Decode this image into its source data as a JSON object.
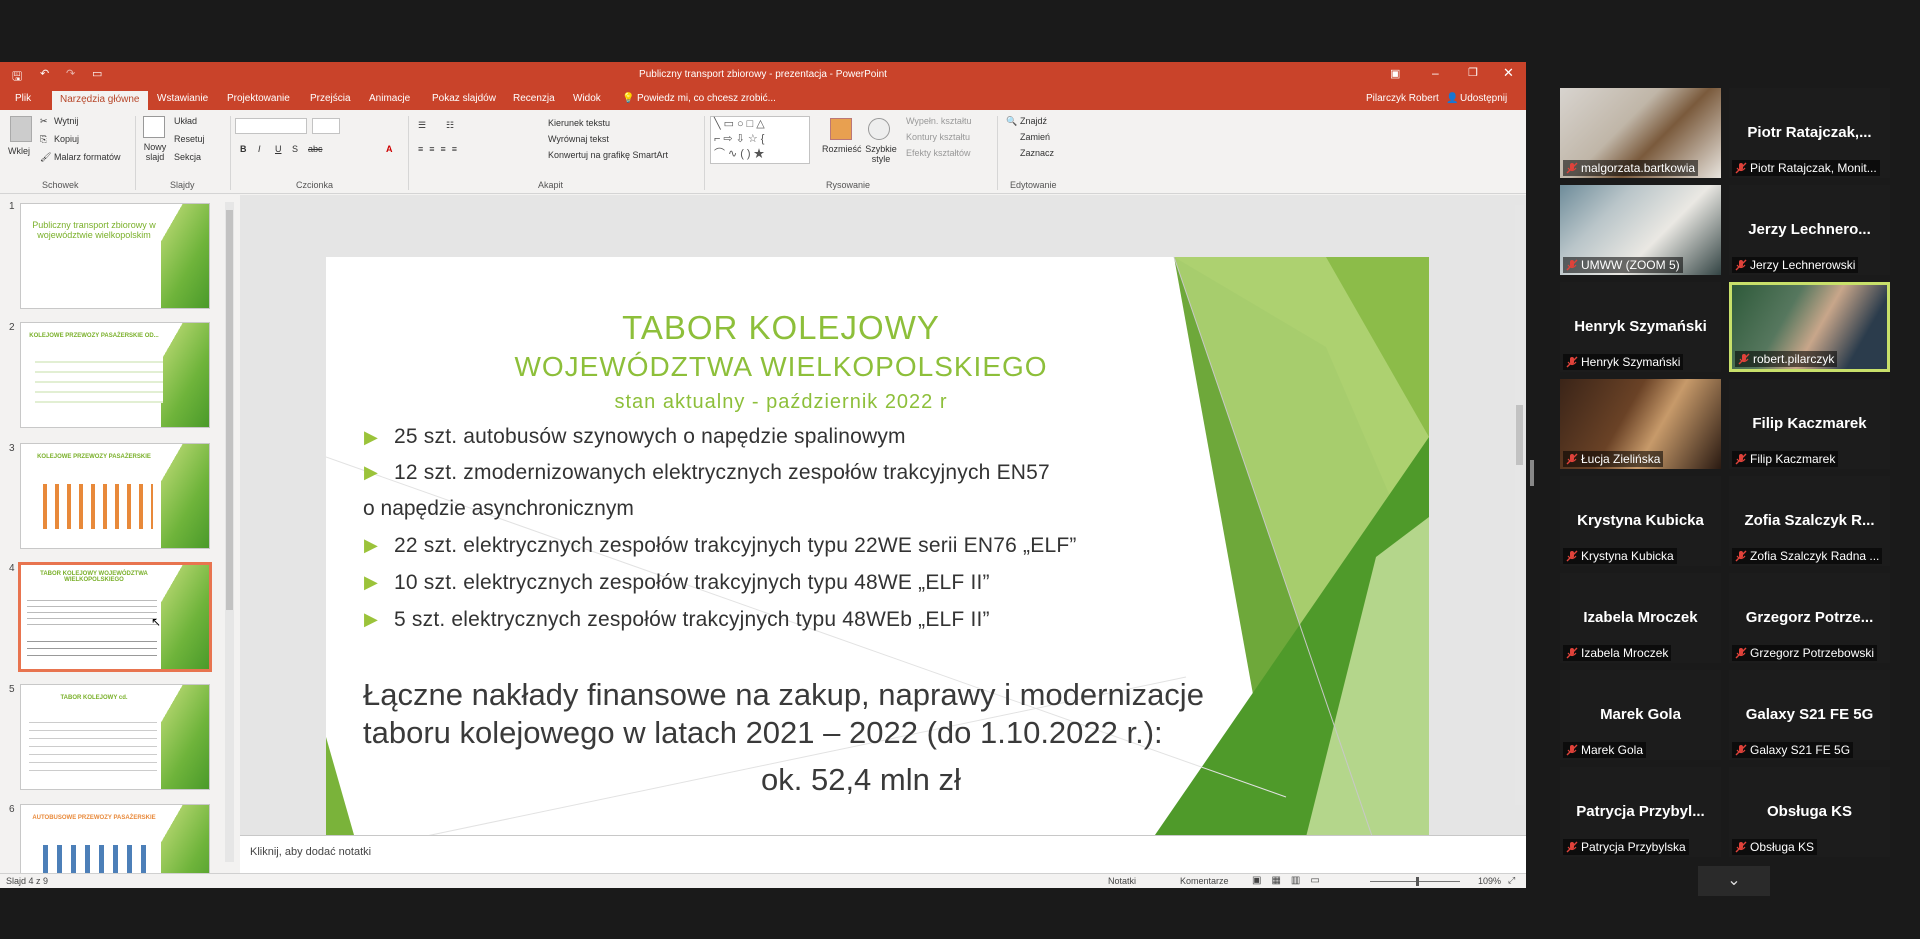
{
  "window": {
    "title": "Publiczny transport zbiorowy - prezentacja - PowerPoint"
  },
  "tabs": [
    "Plik",
    "Narzędzia główne",
    "Wstawianie",
    "Projektowanie",
    "Przejścia",
    "Animacje",
    "Pokaz slajdów",
    "Recenzja",
    "Widok"
  ],
  "tell_me": "Powiedz mi, co chcesz zrobić...",
  "user": "Pilarczyk Robert",
  "share": "Udostępnij",
  "ribbon": {
    "clipboard": {
      "paste": "Wklej",
      "cut": "Wytnij",
      "copy": "Kopiuj",
      "painter": "Malarz formatów",
      "group": "Schowek"
    },
    "slides": {
      "new": "Nowy slajd",
      "layout": "Układ",
      "reset": "Resetuj",
      "section": "Sekcja",
      "group": "Slajdy"
    },
    "font": {
      "group": "Czcionka"
    },
    "paragraph": {
      "direction": "Kierunek tekstu",
      "align": "Wyrównaj tekst",
      "smartart": "Konwertuj na grafikę SmartArt",
      "group": "Akapit"
    },
    "drawing": {
      "arrange": "Rozmieść",
      "quick": "Szybkie style",
      "fill": "Wypełn. kształtu",
      "outline": "Kontury kształtu",
      "effects": "Efekty kształtów",
      "group": "Rysowanie"
    },
    "editing": {
      "find": "Znajdź",
      "replace": "Zamień",
      "select": "Zaznacz",
      "group": "Edytowanie"
    }
  },
  "thumbnails": [
    {
      "num": "1",
      "title": "Publiczny transport zbiorowy w województwie wielkopolskim"
    },
    {
      "num": "2",
      "title": "KOLEJOWE PRZEWOZY PASAŻERSKIE OD..."
    },
    {
      "num": "3",
      "title": "KOLEJOWE PRZEWOZY PASAŻERSKIE"
    },
    {
      "num": "4",
      "title": "TABOR KOLEJOWY WOJEWÓDZTWA WIELKOPOLSKIEGO"
    },
    {
      "num": "5",
      "title": "TABOR KOLEJOWY cd."
    },
    {
      "num": "6",
      "title": "AUTOBUSOWE PRZEWOZY PASAŻERSKIE"
    }
  ],
  "slide": {
    "title1": "TABOR KOLEJOWY",
    "title2": "WOJEWÓDZTWA WIELKOPOLSKIEGO",
    "subtitle": "stan aktualny - październik 2022 r",
    "bullets": [
      "25 szt. autobusów szynowych o napędzie spalinowym",
      "12 szt. zmodernizowanych elektrycznych zespołów trakcyjnych EN57",
      "22 szt. elektrycznych zespołów trakcyjnych typu 22WE serii EN76 „ELF”",
      "10 szt. elektrycznych zespołów trakcyjnych typu 48WE „ELF II”",
      "5 szt. elektrycznych zespołów trakcyjnych typu 48WEb „ELF II”"
    ],
    "continuation": "o napędzie asynchronicznym",
    "summary1": "Łączne nakłady finansowe na zakup, naprawy i modernizacje",
    "summary2": "taboru kolejowego w latach 2021 – 2022 (do 1.10.2022 r.):",
    "amount": "ok. 52,4 mln zł"
  },
  "notes_placeholder": "Kliknij, aby dodać notatki",
  "status": {
    "slide": "Slajd 4 z 9",
    "notes": "Notatki",
    "comments": "Komentarze",
    "zoom": "109%"
  },
  "participants": [
    {
      "tile": "video",
      "caption": "malgorzata.bartkowia"
    },
    {
      "tile": "name",
      "name": "Piotr  Ratajczak,...",
      "caption": "Piotr Ratajczak, Monit..."
    },
    {
      "tile": "video",
      "caption": "UMWW (ZOOM 5)"
    },
    {
      "tile": "name",
      "name": "Jerzy  Lechnero...",
      "caption": "Jerzy Lechnerowski"
    },
    {
      "tile": "name",
      "name": "Henryk Szymański",
      "caption": "Henryk Szymański"
    },
    {
      "tile": "video",
      "caption": "robert.pilarczyk"
    },
    {
      "tile": "video",
      "caption": "Łucja Zielińska"
    },
    {
      "tile": "name",
      "name": "Filip Kaczmarek",
      "caption": "Filip Kaczmarek"
    },
    {
      "tile": "name",
      "name": "Krystyna Kubicka",
      "caption": "Krystyna Kubicka"
    },
    {
      "tile": "name",
      "name": "Zofia  Szalczyk  R...",
      "caption": "Zofia Szalczyk Radna ..."
    },
    {
      "tile": "name",
      "name": "Izabela Mroczek",
      "caption": "Izabela Mroczek"
    },
    {
      "tile": "name",
      "name": "Grzegorz  Potrze...",
      "caption": "Grzegorz Potrzebowski"
    },
    {
      "tile": "name",
      "name": "Marek Gola",
      "caption": "Marek Gola"
    },
    {
      "tile": "name",
      "name": "Galaxy S21 FE 5G",
      "caption": "Galaxy S21 FE 5G"
    },
    {
      "tile": "name",
      "name": "Patrycja  Przybyl...",
      "caption": "Patrycja Przybylska"
    },
    {
      "tile": "name",
      "name": "Obsługa KS",
      "caption": "Obsługa KS"
    }
  ],
  "colors": {
    "titlebar": "#c9432a",
    "slide_green": "#8dbf3a",
    "muted_mic": "#e0423a",
    "highlight": "#c8e06a"
  }
}
